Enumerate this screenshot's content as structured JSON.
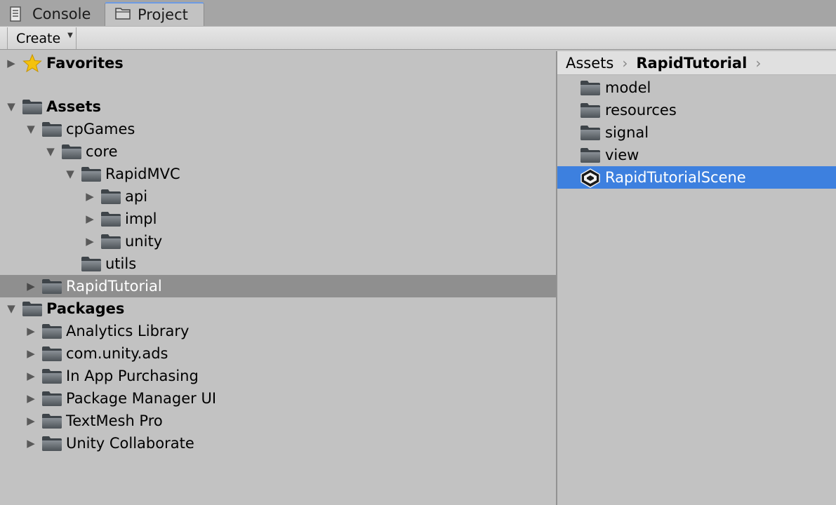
{
  "tabs": [
    {
      "label": "Console",
      "icon": "console-icon"
    },
    {
      "label": "Project",
      "icon": "project-folder-icon"
    }
  ],
  "toolbar": {
    "create_label": "Create"
  },
  "tree": {
    "favorites": "Favorites",
    "assets": "Assets",
    "cpGames": "cpGames",
    "core": "core",
    "rapidmvc": "RapidMVC",
    "api": "api",
    "impl": "impl",
    "unity": "unity",
    "utils": "utils",
    "rapidtutorial": "RapidTutorial",
    "packages": "Packages",
    "pkg_analytics": "Analytics Library",
    "pkg_ads": "com.unity.ads",
    "pkg_iap": "In App Purchasing",
    "pkg_pm": "Package Manager UI",
    "pkg_tmp": "TextMesh Pro",
    "pkg_collab": "Unity Collaborate"
  },
  "breadcrumb": {
    "root": "Assets",
    "current": "RapidTutorial"
  },
  "contents": {
    "model": "model",
    "resources": "resources",
    "signal": "signal",
    "view": "view",
    "scene": "RapidTutorialScene"
  },
  "colors": {
    "selection": "#3d80df",
    "tree_selection": "#8f8f8f",
    "background": "#c2c2c2"
  }
}
